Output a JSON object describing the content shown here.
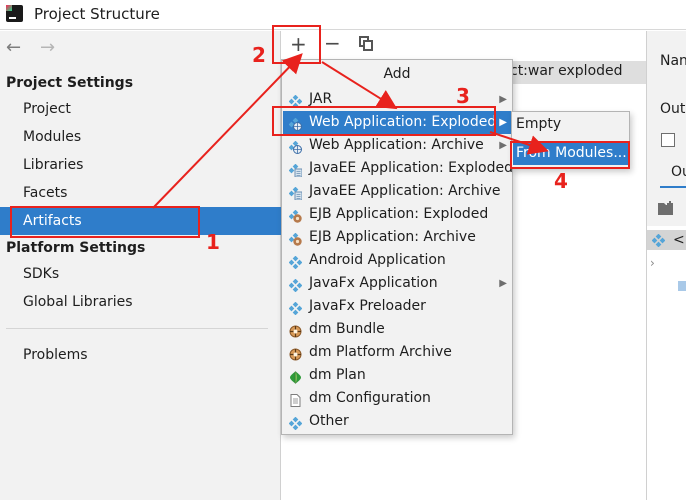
{
  "window": {
    "title": "Project Structure"
  },
  "left_panel": {
    "back_arrow": "←",
    "forward_arrow": "→",
    "project_settings_header": "Project Settings",
    "project_settings_items": [
      "Project",
      "Modules",
      "Libraries",
      "Facets",
      "Artifacts"
    ],
    "selected_item": "Artifacts",
    "platform_settings_header": "Platform Settings",
    "platform_settings_items": [
      "SDKs",
      "Global Libraries"
    ],
    "problems_item": "Problems"
  },
  "toolbar": {
    "add_glyph": "+",
    "remove_glyph": "−"
  },
  "artifact_list": {
    "row_text": "ct:war exploded"
  },
  "right_panel": {
    "name_label": "Nan",
    "output_label": "Out",
    "tab_label": "Ou",
    "tree_item": "<"
  },
  "add_menu": {
    "title": "Add",
    "items": [
      {
        "label": "JAR",
        "icon": "diamond-icon",
        "submenu": true
      },
      {
        "label": "Web Application: Exploded",
        "icon": "web-app-icon",
        "submenu": true,
        "selected": true
      },
      {
        "label": "Web Application: Archive",
        "icon": "web-app-icon",
        "submenu": true
      },
      {
        "label": "JavaEE Application: Exploded",
        "icon": "javaee-icon",
        "submenu": false
      },
      {
        "label": "JavaEE Application: Archive",
        "icon": "javaee-icon",
        "submenu": false
      },
      {
        "label": "EJB Application: Exploded",
        "icon": "ejb-icon",
        "submenu": false
      },
      {
        "label": "EJB Application: Archive",
        "icon": "ejb-icon",
        "submenu": false
      },
      {
        "label": "Android Application",
        "icon": "diamond-icon",
        "submenu": false
      },
      {
        "label": "JavaFx Application",
        "icon": "diamond-icon",
        "submenu": true
      },
      {
        "label": "JavaFx Preloader",
        "icon": "diamond-icon",
        "submenu": false
      },
      {
        "label": "dm Bundle",
        "icon": "bundle-icon",
        "submenu": false
      },
      {
        "label": "dm Platform Archive",
        "icon": "bundle-icon",
        "submenu": false
      },
      {
        "label": "dm Plan",
        "icon": "plan-icon",
        "submenu": false
      },
      {
        "label": "dm Configuration",
        "icon": "document-icon",
        "submenu": false
      },
      {
        "label": "Other",
        "icon": "diamond-icon",
        "submenu": false
      }
    ]
  },
  "submenu": {
    "items": [
      "Empty",
      "From Modules..."
    ],
    "selected_index": 1
  },
  "annotations": {
    "numbers": [
      "1",
      "2",
      "3",
      "4"
    ],
    "color": "#e8221d"
  },
  "colors": {
    "selection": "#2f7dca",
    "panel_bg": "#f2f2f2",
    "annotation": "#e8221d"
  }
}
